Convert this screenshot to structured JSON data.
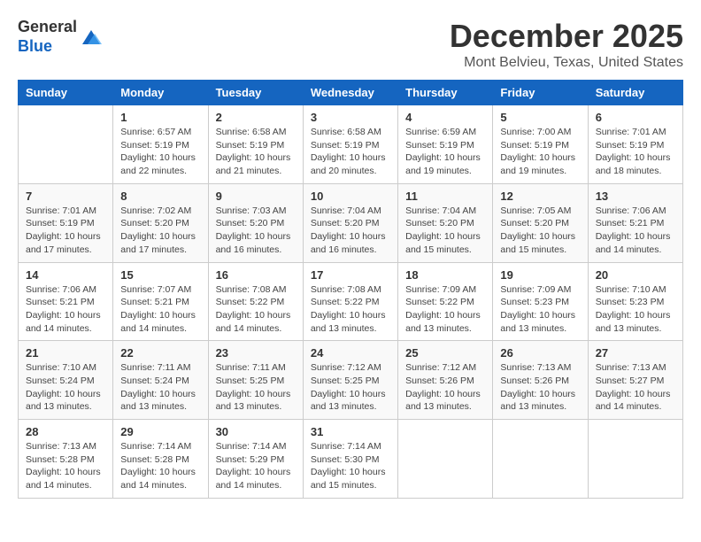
{
  "logo": {
    "general": "General",
    "blue": "Blue"
  },
  "header": {
    "month": "December 2025",
    "location": "Mont Belvieu, Texas, United States"
  },
  "weekdays": [
    "Sunday",
    "Monday",
    "Tuesday",
    "Wednesday",
    "Thursday",
    "Friday",
    "Saturday"
  ],
  "weeks": [
    [
      {
        "day": "",
        "info": ""
      },
      {
        "day": "1",
        "info": "Sunrise: 6:57 AM\nSunset: 5:19 PM\nDaylight: 10 hours\nand 22 minutes."
      },
      {
        "day": "2",
        "info": "Sunrise: 6:58 AM\nSunset: 5:19 PM\nDaylight: 10 hours\nand 21 minutes."
      },
      {
        "day": "3",
        "info": "Sunrise: 6:58 AM\nSunset: 5:19 PM\nDaylight: 10 hours\nand 20 minutes."
      },
      {
        "day": "4",
        "info": "Sunrise: 6:59 AM\nSunset: 5:19 PM\nDaylight: 10 hours\nand 19 minutes."
      },
      {
        "day": "5",
        "info": "Sunrise: 7:00 AM\nSunset: 5:19 PM\nDaylight: 10 hours\nand 19 minutes."
      },
      {
        "day": "6",
        "info": "Sunrise: 7:01 AM\nSunset: 5:19 PM\nDaylight: 10 hours\nand 18 minutes."
      }
    ],
    [
      {
        "day": "7",
        "info": "Sunrise: 7:01 AM\nSunset: 5:19 PM\nDaylight: 10 hours\nand 17 minutes."
      },
      {
        "day": "8",
        "info": "Sunrise: 7:02 AM\nSunset: 5:20 PM\nDaylight: 10 hours\nand 17 minutes."
      },
      {
        "day": "9",
        "info": "Sunrise: 7:03 AM\nSunset: 5:20 PM\nDaylight: 10 hours\nand 16 minutes."
      },
      {
        "day": "10",
        "info": "Sunrise: 7:04 AM\nSunset: 5:20 PM\nDaylight: 10 hours\nand 16 minutes."
      },
      {
        "day": "11",
        "info": "Sunrise: 7:04 AM\nSunset: 5:20 PM\nDaylight: 10 hours\nand 15 minutes."
      },
      {
        "day": "12",
        "info": "Sunrise: 7:05 AM\nSunset: 5:20 PM\nDaylight: 10 hours\nand 15 minutes."
      },
      {
        "day": "13",
        "info": "Sunrise: 7:06 AM\nSunset: 5:21 PM\nDaylight: 10 hours\nand 14 minutes."
      }
    ],
    [
      {
        "day": "14",
        "info": "Sunrise: 7:06 AM\nSunset: 5:21 PM\nDaylight: 10 hours\nand 14 minutes."
      },
      {
        "day": "15",
        "info": "Sunrise: 7:07 AM\nSunset: 5:21 PM\nDaylight: 10 hours\nand 14 minutes."
      },
      {
        "day": "16",
        "info": "Sunrise: 7:08 AM\nSunset: 5:22 PM\nDaylight: 10 hours\nand 14 minutes."
      },
      {
        "day": "17",
        "info": "Sunrise: 7:08 AM\nSunset: 5:22 PM\nDaylight: 10 hours\nand 13 minutes."
      },
      {
        "day": "18",
        "info": "Sunrise: 7:09 AM\nSunset: 5:22 PM\nDaylight: 10 hours\nand 13 minutes."
      },
      {
        "day": "19",
        "info": "Sunrise: 7:09 AM\nSunset: 5:23 PM\nDaylight: 10 hours\nand 13 minutes."
      },
      {
        "day": "20",
        "info": "Sunrise: 7:10 AM\nSunset: 5:23 PM\nDaylight: 10 hours\nand 13 minutes."
      }
    ],
    [
      {
        "day": "21",
        "info": "Sunrise: 7:10 AM\nSunset: 5:24 PM\nDaylight: 10 hours\nand 13 minutes."
      },
      {
        "day": "22",
        "info": "Sunrise: 7:11 AM\nSunset: 5:24 PM\nDaylight: 10 hours\nand 13 minutes."
      },
      {
        "day": "23",
        "info": "Sunrise: 7:11 AM\nSunset: 5:25 PM\nDaylight: 10 hours\nand 13 minutes."
      },
      {
        "day": "24",
        "info": "Sunrise: 7:12 AM\nSunset: 5:25 PM\nDaylight: 10 hours\nand 13 minutes."
      },
      {
        "day": "25",
        "info": "Sunrise: 7:12 AM\nSunset: 5:26 PM\nDaylight: 10 hours\nand 13 minutes."
      },
      {
        "day": "26",
        "info": "Sunrise: 7:13 AM\nSunset: 5:26 PM\nDaylight: 10 hours\nand 13 minutes."
      },
      {
        "day": "27",
        "info": "Sunrise: 7:13 AM\nSunset: 5:27 PM\nDaylight: 10 hours\nand 14 minutes."
      }
    ],
    [
      {
        "day": "28",
        "info": "Sunrise: 7:13 AM\nSunset: 5:28 PM\nDaylight: 10 hours\nand 14 minutes."
      },
      {
        "day": "29",
        "info": "Sunrise: 7:14 AM\nSunset: 5:28 PM\nDaylight: 10 hours\nand 14 minutes."
      },
      {
        "day": "30",
        "info": "Sunrise: 7:14 AM\nSunset: 5:29 PM\nDaylight: 10 hours\nand 14 minutes."
      },
      {
        "day": "31",
        "info": "Sunrise: 7:14 AM\nSunset: 5:30 PM\nDaylight: 10 hours\nand 15 minutes."
      },
      {
        "day": "",
        "info": ""
      },
      {
        "day": "",
        "info": ""
      },
      {
        "day": "",
        "info": ""
      }
    ]
  ]
}
